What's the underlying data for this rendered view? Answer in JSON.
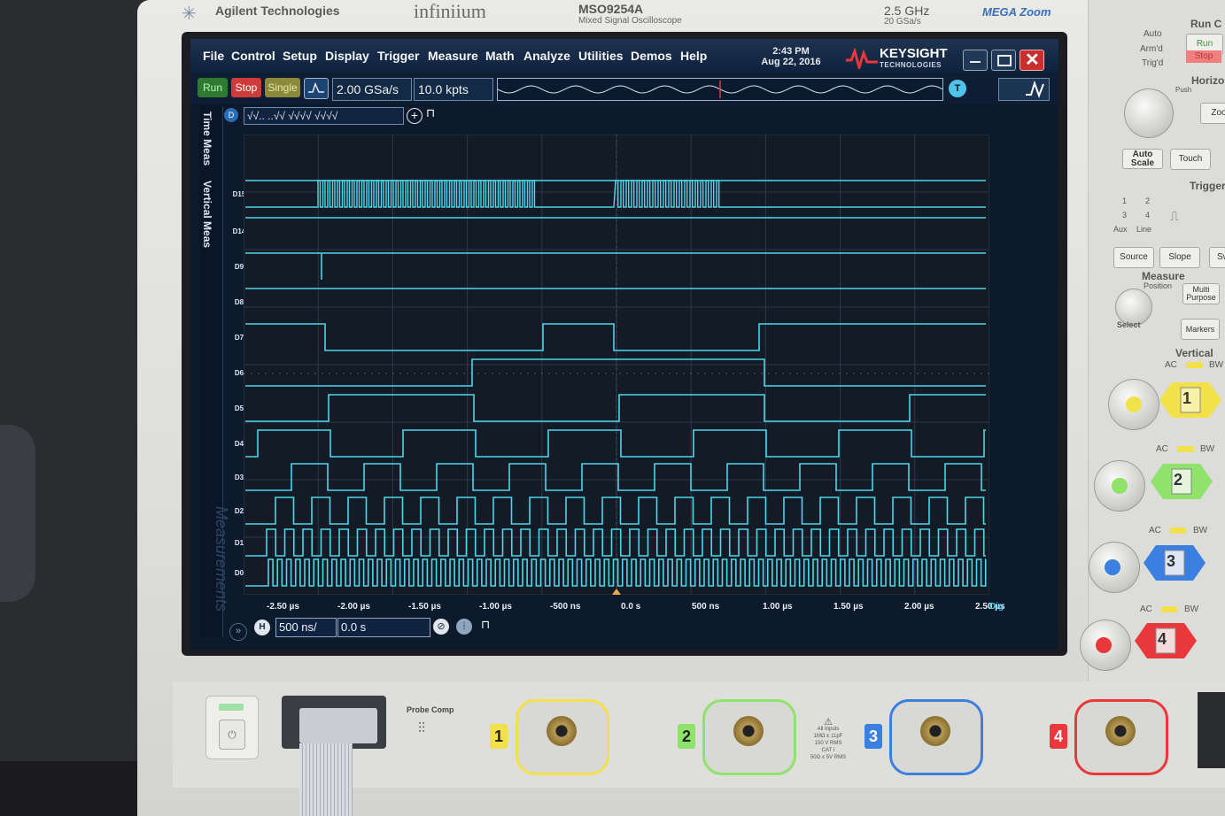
{
  "header": {
    "maker": "Agilent Technologies",
    "series": "infiniium",
    "model": "MSO9254A",
    "model_sub": "Mixed Signal Oscilloscope",
    "bandwidth": "2.5 GHz",
    "sample_rate_label": "20 GSa/s",
    "megazoom": "MEGA Zoom"
  },
  "menu": {
    "items": [
      "File",
      "Control",
      "Setup",
      "Display",
      "Trigger",
      "Measure",
      "Math",
      "Analyze",
      "Utilities",
      "Demos",
      "Help"
    ],
    "time": "2:43 PM",
    "date": "Aug 22, 2016",
    "logo": "KEYSIGHT",
    "logo_sub": "TECHNOLOGIES"
  },
  "toolbar": {
    "run": "Run",
    "stop": "Stop",
    "single": "Single",
    "sample_rate": "2.00 GSa/s",
    "memory_depth": "10.0 kpts",
    "trigger_badge": "T"
  },
  "side_tabs": [
    "Time Meas",
    "Vertical Meas"
  ],
  "measurements_watermark": "Measurements",
  "digital_bar": {
    "badge": "D",
    "pattern": "√√..  ..√√ √√√√ √√√√"
  },
  "channels": [
    "D15",
    "D14",
    "D9",
    "D8",
    "D7",
    "D6",
    "D5",
    "D4",
    "D3",
    "D2",
    "D1",
    "D0"
  ],
  "time_axis": {
    "labels": [
      "-2.50 µs",
      "-2.00 µs",
      "-1.50 µs",
      "-1.00 µs",
      "-500 ns",
      "0.0 s",
      "500 ns",
      "1.00 µs",
      "1.50 µs",
      "2.00 µs",
      "2.50 µs"
    ],
    "dig_label": "Dig"
  },
  "horizontal": {
    "badge": "H",
    "scale": "500 ns/",
    "position": "0.0 s"
  },
  "panel": {
    "run_control": "Run C",
    "auto": "Auto",
    "armd": "Arm'd",
    "trigd": "Trig'd",
    "run_btn": "Run",
    "stop_btn": "Stop",
    "horizontal": "Horizo",
    "push_vernier": "Push",
    "zoom_btn": "Zoo",
    "auto_scale": "Auto Scale",
    "touch": "Touch",
    "trigger": "Trigger",
    "trig_nums": [
      "1",
      "2",
      "3",
      "4",
      "Aux",
      "Line"
    ],
    "source": "Source",
    "slope": "Slope",
    "sweep": "Sw",
    "measure": "Measure",
    "position": "Position",
    "multi_purpose": "Multi Purpose",
    "select": "Select",
    "markers": "Markers",
    "vertical": "Vertical",
    "ac": "AC",
    "bw": "BW",
    "ch_numbers": [
      "1",
      "2",
      "3",
      "4"
    ]
  },
  "front": {
    "probe_comp": "Probe Comp",
    "all_inputs": "All Inputs",
    "specs": [
      "1MΩ ± 11pF",
      "150 V RMS",
      "CAT I",
      "50Ω ≤ 5V RMS"
    ],
    "inputs": [
      "1",
      "2",
      "3",
      "4"
    ]
  },
  "colors": {
    "trace": "#4fd6ea",
    "ch1": "#f2e14a",
    "ch2": "#8fe36a",
    "ch3": "#3b7fe0",
    "ch4": "#e8383c",
    "run_green": "#3d8f3c",
    "stop_red": "#cf3a3a"
  }
}
